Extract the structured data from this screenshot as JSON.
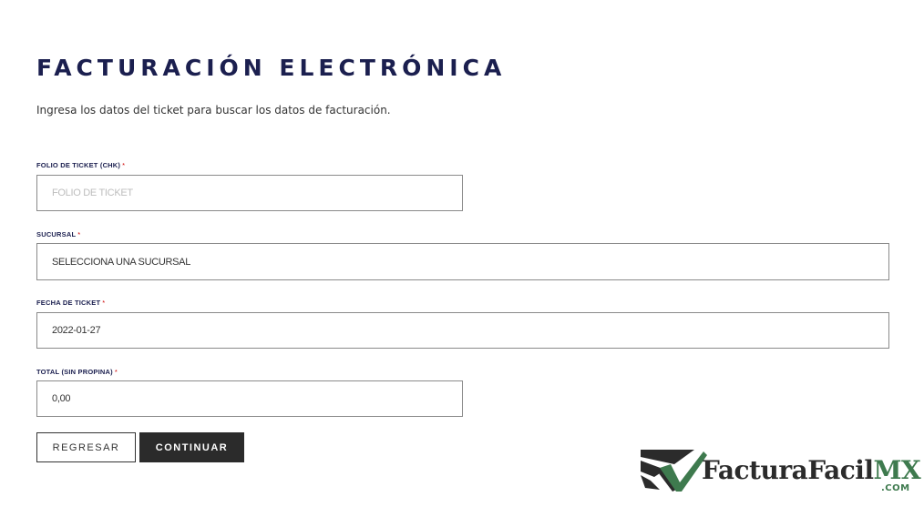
{
  "header": {
    "title": "FACTURACIÓN ELECTRÓNICA",
    "subtitle": "Ingresa los datos del ticket para buscar los datos de facturación."
  },
  "form": {
    "folio": {
      "label": "FOLIO DE TICKET (CHK)",
      "required_mark": "*",
      "placeholder": "FOLIO DE TICKET",
      "value": ""
    },
    "sucursal": {
      "label": "SUCURSAL",
      "required_mark": "*",
      "value": "SELECCIONA UNA SUCURSAL"
    },
    "fecha": {
      "label": "FECHA DE TICKET",
      "required_mark": "*",
      "value": "2022-01-27"
    },
    "total": {
      "label": "TOTAL (SIN PROPINA)",
      "required_mark": "*",
      "value": "0,00"
    }
  },
  "buttons": {
    "back_label": "REGRESAR",
    "continue_label": "CONTINUAR"
  },
  "logo": {
    "brand_dark": "FacturaFacil",
    "brand_green": "MX",
    "suffix": ".COM",
    "icon": "check-document-logo-icon"
  },
  "colors": {
    "title": "#1b1f4f",
    "button_dark": "#2b2b2b",
    "brand_green": "#3e7a4e",
    "required": "#cc0000"
  }
}
